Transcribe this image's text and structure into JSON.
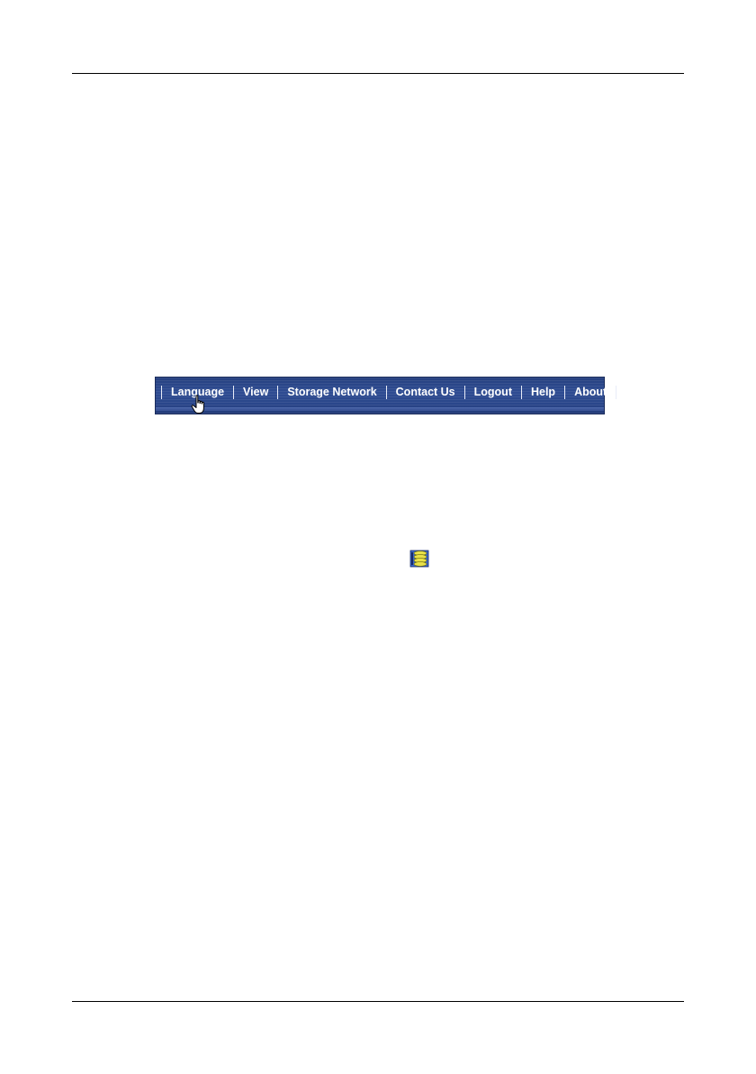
{
  "menu": {
    "items": [
      {
        "label": "Language"
      },
      {
        "label": "View"
      },
      {
        "label": "Storage Network"
      },
      {
        "label": "Contact Us"
      },
      {
        "label": "Logout"
      },
      {
        "label": "Help"
      },
      {
        "label": "About"
      }
    ]
  },
  "icons": {
    "cursor": "hand-pointer-icon",
    "inline": "storage-stack-icon"
  },
  "colors": {
    "menubar": "#2e4c92",
    "menu_text": "#ffffff",
    "icon_fill": "#e8e048",
    "icon_accent": "#3a66c8"
  }
}
